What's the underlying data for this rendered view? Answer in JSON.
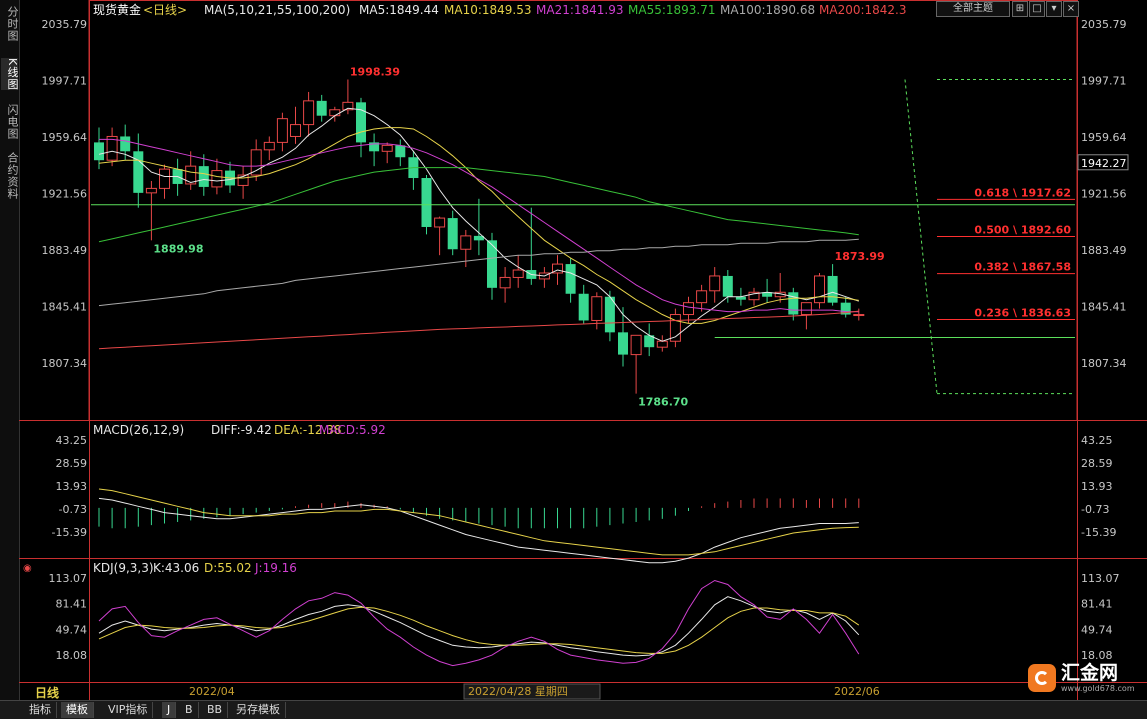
{
  "sidebar": {
    "tabs": [
      "分时图",
      "K线图",
      "闪电图",
      "合约资料"
    ],
    "active": 1
  },
  "header": {
    "title": "现货黄金",
    "period": "<日线>",
    "ma_label": "MA(5,10,21,55,100,200)",
    "ma_values": [
      {
        "text": "MA5:1849.44",
        "color": "#e8e8e8"
      },
      {
        "text": "MA10:1849.53",
        "color": "#e6d24a"
      },
      {
        "text": "MA21:1841.93",
        "color": "#d040d0"
      },
      {
        "text": "MA55:1893.71",
        "color": "#38c038"
      },
      {
        "text": "MA100:1890.68",
        "color": "#a8a8a8"
      },
      {
        "text": "MA200:1842.3",
        "color": "#e84848"
      }
    ],
    "theme_button": "全部主题",
    "win_buttons": [
      "⊞",
      "□",
      "▾",
      "×"
    ]
  },
  "colors": {
    "up": "#e84848",
    "down": "#38d890",
    "axis": "#c93030",
    "fib": "#ff3030",
    "ma5": "#e8e8e8",
    "ma10": "#e6d24a",
    "ma21": "#d040d0",
    "ma55": "#38c038",
    "ma100": "#a8a8a8",
    "ma200": "#e84848"
  },
  "macd_header": {
    "label": "MACD(26,12,9)",
    "diff": "DIFF:-9.42",
    "dea": "DEA:-12.38",
    "macd": "MACD:5.92"
  },
  "kdj_header": {
    "label": "KDJ(9,3,3)",
    "k": "K:43.06",
    "d": "D:55.02",
    "j": "J:19.16"
  },
  "date_labels": [
    "2022/04",
    "2022/04/28 星期四",
    "2022/06"
  ],
  "current_price": "1942.27",
  "bottom_tabs": [
    "日线",
    "指标",
    "模板",
    "VIP指标",
    "J",
    "B",
    "BB",
    "另存模板"
  ],
  "logo": {
    "text": "汇金网",
    "sub": "www.gold678.com"
  },
  "chart_data": {
    "type": "candlestick",
    "title": "现货黄金",
    "price_ticks": [
      2035.79,
      1997.71,
      1959.64,
      1921.56,
      1883.49,
      1845.41,
      1807.34
    ],
    "price_ylim": [
      1770,
      2035.79
    ],
    "annotations": [
      {
        "text": "1998.39",
        "value": 1998.39,
        "kind": "high"
      },
      {
        "text": "1889.98",
        "value": 1889.98,
        "kind": "low"
      },
      {
        "text": "1786.70",
        "value": 1786.7,
        "kind": "low"
      },
      {
        "text": "1873.99",
        "value": 1873.99,
        "kind": "high"
      }
    ],
    "fib_levels": [
      {
        "text": "0.618 \\ 1917.62",
        "value": 1917.62
      },
      {
        "text": "0.500 \\ 1892.60",
        "value": 1892.6
      },
      {
        "text": "0.382 \\ 1867.58",
        "value": 1867.58
      },
      {
        "text": "0.236 \\ 1836.63",
        "value": 1836.63
      }
    ],
    "hlines": [
      1914.0,
      1824.5
    ],
    "candles": [
      {
        "o": 1956,
        "h": 1966,
        "l": 1938,
        "c": 1944
      },
      {
        "o": 1944,
        "h": 1966,
        "l": 1940,
        "c": 1960
      },
      {
        "o": 1960,
        "h": 1968,
        "l": 1944,
        "c": 1950
      },
      {
        "o": 1950,
        "h": 1962,
        "l": 1912,
        "c": 1922
      },
      {
        "o": 1922,
        "h": 1930,
        "l": 1890,
        "c": 1925
      },
      {
        "o": 1925,
        "h": 1941,
        "l": 1918,
        "c": 1938
      },
      {
        "o": 1938,
        "h": 1945,
        "l": 1920,
        "c": 1928
      },
      {
        "o": 1928,
        "h": 1950,
        "l": 1924,
        "c": 1940
      },
      {
        "o": 1940,
        "h": 1948,
        "l": 1920,
        "c": 1926
      },
      {
        "o": 1926,
        "h": 1945,
        "l": 1921,
        "c": 1937
      },
      {
        "o": 1937,
        "h": 1943,
        "l": 1922,
        "c": 1927
      },
      {
        "o": 1927,
        "h": 1940,
        "l": 1918,
        "c": 1934
      },
      {
        "o": 1934,
        "h": 1958,
        "l": 1930,
        "c": 1951
      },
      {
        "o": 1951,
        "h": 1960,
        "l": 1944,
        "c": 1956
      },
      {
        "o": 1956,
        "h": 1976,
        "l": 1950,
        "c": 1972
      },
      {
        "o": 1960,
        "h": 1980,
        "l": 1955,
        "c": 1968
      },
      {
        "o": 1968,
        "h": 1990,
        "l": 1960,
        "c": 1984
      },
      {
        "o": 1984,
        "h": 1988,
        "l": 1970,
        "c": 1974
      },
      {
        "o": 1974,
        "h": 1980,
        "l": 1970,
        "c": 1978
      },
      {
        "o": 1978,
        "h": 1998.39,
        "l": 1975,
        "c": 1983
      },
      {
        "o": 1983,
        "h": 1986,
        "l": 1946,
        "c": 1956
      },
      {
        "o": 1956,
        "h": 1962,
        "l": 1940,
        "c": 1950
      },
      {
        "o": 1950,
        "h": 1956,
        "l": 1942,
        "c": 1954
      },
      {
        "o": 1954,
        "h": 1958,
        "l": 1940,
        "c": 1946
      },
      {
        "o": 1946,
        "h": 1950,
        "l": 1924,
        "c": 1932
      },
      {
        "o": 1932,
        "h": 1934,
        "l": 1894,
        "c": 1899
      },
      {
        "o": 1899,
        "h": 1906,
        "l": 1880,
        "c": 1905
      },
      {
        "o": 1905,
        "h": 1910,
        "l": 1880,
        "c": 1884
      },
      {
        "o": 1884,
        "h": 1897,
        "l": 1872,
        "c": 1893
      },
      {
        "o": 1893,
        "h": 1918,
        "l": 1880,
        "c": 1890
      },
      {
        "o": 1890,
        "h": 1895,
        "l": 1850,
        "c": 1858
      },
      {
        "o": 1858,
        "h": 1872,
        "l": 1848,
        "c": 1865
      },
      {
        "o": 1865,
        "h": 1880,
        "l": 1858,
        "c": 1870
      },
      {
        "o": 1870,
        "h": 1912,
        "l": 1860,
        "c": 1864
      },
      {
        "o": 1864,
        "h": 1872,
        "l": 1858,
        "c": 1868
      },
      {
        "o": 1868,
        "h": 1880,
        "l": 1860,
        "c": 1874
      },
      {
        "o": 1874,
        "h": 1878,
        "l": 1848,
        "c": 1854
      },
      {
        "o": 1854,
        "h": 1860,
        "l": 1834,
        "c": 1836
      },
      {
        "o": 1836,
        "h": 1855,
        "l": 1830,
        "c": 1852
      },
      {
        "o": 1852,
        "h": 1856,
        "l": 1822,
        "c": 1828
      },
      {
        "o": 1828,
        "h": 1845,
        "l": 1805,
        "c": 1813
      },
      {
        "o": 1813,
        "h": 1818,
        "l": 1786.7,
        "c": 1826
      },
      {
        "o": 1826,
        "h": 1834,
        "l": 1812,
        "c": 1818
      },
      {
        "o": 1818,
        "h": 1826,
        "l": 1815,
        "c": 1822
      },
      {
        "o": 1822,
        "h": 1844,
        "l": 1818,
        "c": 1840
      },
      {
        "o": 1840,
        "h": 1852,
        "l": 1834,
        "c": 1848
      },
      {
        "o": 1848,
        "h": 1860,
        "l": 1842,
        "c": 1856
      },
      {
        "o": 1856,
        "h": 1872,
        "l": 1848,
        "c": 1866
      },
      {
        "o": 1866,
        "h": 1870,
        "l": 1848,
        "c": 1852
      },
      {
        "o": 1852,
        "h": 1858,
        "l": 1846,
        "c": 1850
      },
      {
        "o": 1850,
        "h": 1858,
        "l": 1846,
        "c": 1855
      },
      {
        "o": 1855,
        "h": 1864,
        "l": 1848,
        "c": 1852
      },
      {
        "o": 1852,
        "h": 1868,
        "l": 1848,
        "c": 1855
      },
      {
        "o": 1855,
        "h": 1858,
        "l": 1836,
        "c": 1840
      },
      {
        "o": 1840,
        "h": 1846,
        "l": 1830,
        "c": 1848
      },
      {
        "o": 1848,
        "h": 1868,
        "l": 1844,
        "c": 1866
      },
      {
        "o": 1866,
        "h": 1873.99,
        "l": 1846,
        "c": 1848
      },
      {
        "o": 1848,
        "h": 1852,
        "l": 1838,
        "c": 1840
      },
      {
        "o": 1840,
        "h": 1844,
        "l": 1836,
        "c": 1840
      }
    ],
    "ma_series": [
      {
        "color": "#e8e8e8",
        "values": [
          1948,
          1950,
          1948,
          1944,
          1936,
          1933,
          1933,
          1929,
          1931,
          1930,
          1931,
          1933,
          1937,
          1942,
          1946,
          1952,
          1961,
          1967,
          1974,
          1979,
          1978,
          1974,
          1968,
          1961,
          1950,
          1938,
          1924,
          1912,
          1903,
          1895,
          1887,
          1878,
          1872,
          1867,
          1866,
          1870,
          1868,
          1864,
          1860,
          1852,
          1840,
          1832,
          1826,
          1822,
          1825,
          1832,
          1839,
          1845,
          1852,
          1852,
          1854,
          1855,
          1854,
          1852,
          1850,
          1852,
          1855,
          1852,
          1849
        ]
      },
      {
        "color": "#e6d24a",
        "values": [
          1942,
          1943,
          1944,
          1944,
          1942,
          1940,
          1938,
          1936,
          1935,
          1933,
          1932,
          1932,
          1933,
          1935,
          1938,
          1941,
          1945,
          1950,
          1955,
          1960,
          1963,
          1965,
          1966,
          1966,
          1965,
          1960,
          1954,
          1947,
          1939,
          1930,
          1923,
          1914,
          1906,
          1898,
          1890,
          1884,
          1878,
          1873,
          1867,
          1862,
          1856,
          1850,
          1845,
          1840,
          1836,
          1834,
          1834,
          1836,
          1839,
          1842,
          1845,
          1848,
          1850,
          1851,
          1851,
          1852,
          1852,
          1851,
          1849.5
        ]
      },
      {
        "color": "#d040d0",
        "values": [
          1958,
          1958,
          1957,
          1955,
          1953,
          1951,
          1949,
          1947,
          1945,
          1943,
          1941,
          1940,
          1940,
          1941,
          1943,
          1945,
          1947,
          1949,
          1951,
          1953,
          1954,
          1955,
          1955,
          1954,
          1952,
          1949,
          1945,
          1941,
          1936,
          1931,
          1926,
          1920,
          1914,
          1908,
          1902,
          1896,
          1890,
          1884,
          1878,
          1872,
          1866,
          1860,
          1855,
          1850,
          1847,
          1845,
          1844,
          1843,
          1842,
          1842,
          1843,
          1843,
          1844,
          1843,
          1843,
          1843,
          1843,
          1842,
          1841.9
        ]
      },
      {
        "color": "#38c038",
        "values": [
          1889,
          1891,
          1893,
          1895,
          1897,
          1899,
          1901,
          1903,
          1905,
          1907,
          1909,
          1911,
          1913,
          1915,
          1918,
          1921,
          1924,
          1927,
          1930,
          1932,
          1934,
          1936,
          1937,
          1938,
          1939,
          1939,
          1939,
          1939,
          1939,
          1938,
          1937,
          1936,
          1935,
          1934,
          1933,
          1931,
          1929,
          1927,
          1925,
          1923,
          1921,
          1919,
          1916,
          1914,
          1912,
          1910,
          1908,
          1906,
          1904,
          1903,
          1902,
          1901,
          1900,
          1899,
          1898,
          1897,
          1896,
          1895,
          1893.7
        ]
      },
      {
        "color": "#a8a8a8",
        "values": [
          1846,
          1847,
          1848,
          1849,
          1850,
          1851,
          1852,
          1853,
          1854,
          1856,
          1857,
          1858,
          1859,
          1860,
          1861,
          1863,
          1864,
          1865,
          1866,
          1867,
          1868,
          1869,
          1870,
          1871,
          1872,
          1873,
          1874,
          1875,
          1876,
          1877,
          1878,
          1879,
          1880,
          1880,
          1881,
          1881,
          1882,
          1882,
          1883,
          1883,
          1884,
          1884,
          1885,
          1885,
          1886,
          1886,
          1887,
          1887,
          1887,
          1888,
          1888,
          1888,
          1889,
          1889,
          1889,
          1890,
          1890,
          1890,
          1890.7
        ]
      },
      {
        "color": "#e84848",
        "values": [
          1817,
          1817.5,
          1818,
          1818.5,
          1819,
          1819.5,
          1820,
          1820.5,
          1821,
          1821.5,
          1822,
          1822.5,
          1823,
          1823.5,
          1824,
          1824.5,
          1825,
          1825.5,
          1826,
          1826.5,
          1827,
          1827.5,
          1828,
          1828.5,
          1829,
          1829.5,
          1830,
          1830.3,
          1830.6,
          1831,
          1831.3,
          1831.6,
          1832,
          1832.3,
          1832.6,
          1833,
          1833.3,
          1833.6,
          1834,
          1834.3,
          1834.6,
          1835,
          1835.3,
          1835.6,
          1836,
          1836.3,
          1836.6,
          1837,
          1837.3,
          1837.6,
          1838,
          1838.3,
          1838.6,
          1839,
          1839.5,
          1840,
          1840.6,
          1841.3,
          1842.3
        ]
      }
    ],
    "macd": {
      "ticks": [
        43.25,
        28.59,
        13.93,
        -0.73,
        -15.39
      ],
      "ylim": [
        -26,
        45
      ],
      "hist": [
        -12,
        -13,
        -13,
        -12,
        -11,
        -10,
        -9,
        -8,
        -7,
        -6,
        -5,
        -4,
        -3,
        -2,
        -1,
        1,
        2,
        3,
        3,
        4,
        3,
        2,
        1,
        -1,
        -3,
        -5,
        -7,
        -8,
        -9,
        -10,
        -11,
        -12,
        -13,
        -13,
        -13,
        -13,
        -13,
        -13,
        -12,
        -11,
        -10,
        -9,
        -8,
        -7,
        -5,
        -2,
        1,
        3,
        4,
        5,
        6,
        6,
        6,
        6,
        5,
        6,
        6,
        6,
        5.92
      ],
      "diff": [
        6,
        5,
        3,
        1,
        -1,
        -3,
        -4,
        -5,
        -6,
        -7,
        -7,
        -6,
        -5,
        -4,
        -3,
        -2,
        -1,
        -1,
        0,
        1,
        2,
        1,
        0,
        -2,
        -5,
        -8,
        -11,
        -14,
        -17,
        -19,
        -21,
        -23,
        -25,
        -26,
        -27,
        -28,
        -29,
        -30,
        -31,
        -32,
        -33,
        -34,
        -35,
        -35,
        -34,
        -32,
        -29,
        -25,
        -22,
        -19,
        -17,
        -15,
        -13,
        -12,
        -11,
        -10,
        -10,
        -10,
        -9.42
      ],
      "dea": [
        12,
        11,
        9,
        7,
        5,
        3,
        1,
        -1,
        -3,
        -4,
        -5,
        -5,
        -5,
        -5,
        -4,
        -4,
        -3,
        -3,
        -2,
        -2,
        -2,
        -1,
        -1,
        -2,
        -3,
        -4,
        -5,
        -7,
        -9,
        -11,
        -13,
        -15,
        -17,
        -19,
        -21,
        -22,
        -23,
        -24,
        -25,
        -26,
        -27,
        -28,
        -29,
        -30,
        -30,
        -30,
        -29,
        -28,
        -26,
        -24,
        -22,
        -20,
        -18,
        -16,
        -15,
        -14,
        -13,
        -12.6,
        -12.38
      ]
    },
    "kdj": {
      "ticks": [
        113.07,
        81.41,
        49.74,
        18.08
      ],
      "ylim": [
        -2,
        115
      ],
      "k": [
        45,
        55,
        60,
        55,
        50,
        48,
        50,
        52,
        55,
        57,
        55,
        52,
        48,
        50,
        55,
        62,
        68,
        72,
        78,
        80,
        78,
        72,
        65,
        58,
        50,
        42,
        36,
        30,
        28,
        27,
        28,
        30,
        32,
        34,
        33,
        30,
        27,
        25,
        22,
        20,
        18,
        17,
        18,
        22,
        30,
        45,
        62,
        80,
        90,
        85,
        78,
        72,
        70,
        74,
        70,
        62,
        70,
        60,
        43.06
      ],
      "d": [
        38,
        45,
        52,
        55,
        54,
        52,
        51,
        51,
        52,
        54,
        55,
        54,
        52,
        51,
        52,
        56,
        60,
        65,
        70,
        75,
        77,
        76,
        72,
        67,
        61,
        54,
        48,
        42,
        37,
        33,
        31,
        30,
        30,
        31,
        32,
        32,
        31,
        29,
        27,
        25,
        23,
        21,
        20,
        20,
        23,
        30,
        40,
        52,
        64,
        72,
        76,
        76,
        74,
        73,
        73,
        70,
        70,
        66,
        55.02
      ],
      "j": [
        60,
        75,
        78,
        58,
        42,
        40,
        48,
        55,
        62,
        64,
        56,
        48,
        40,
        48,
        62,
        75,
        85,
        88,
        95,
        92,
        82,
        65,
        50,
        40,
        28,
        18,
        10,
        5,
        8,
        12,
        18,
        28,
        35,
        40,
        35,
        25,
        18,
        15,
        12,
        10,
        8,
        9,
        14,
        26,
        45,
        75,
        100,
        110,
        105,
        90,
        80,
        65,
        62,
        75,
        62,
        45,
        68,
        45,
        19.16
      ]
    }
  }
}
